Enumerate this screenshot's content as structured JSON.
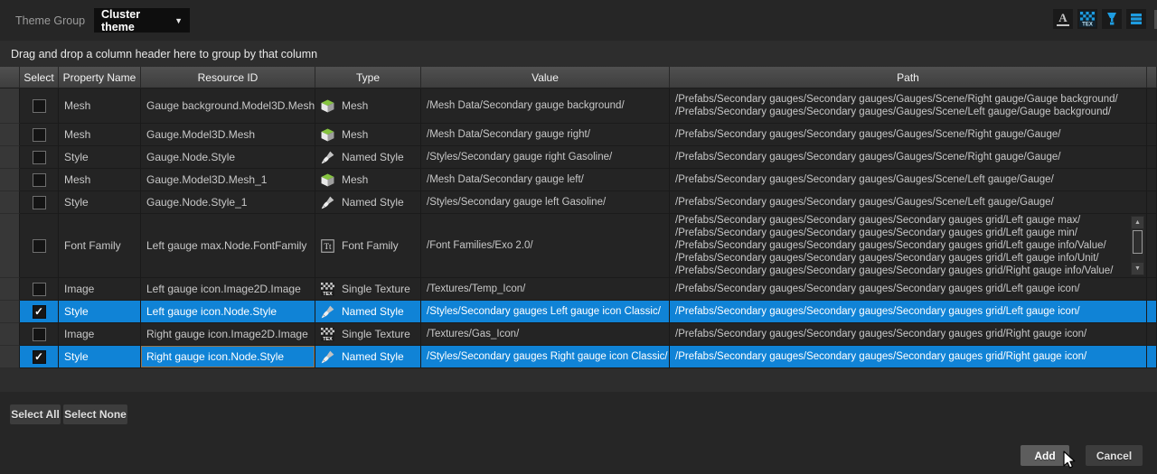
{
  "colors": {
    "selection_blue": "#1083d6",
    "icon_blue": "#1e9ce0",
    "mesh_green": "#86c440"
  },
  "toolbar": {
    "label": "Theme Group",
    "dropdown_value": "Cluster theme",
    "icons": [
      "font-icon",
      "texture-icon",
      "brush-icon",
      "list-icon"
    ]
  },
  "group_bar": "Drag and drop a column header here to group by that column",
  "table": {
    "headers": [
      "Select",
      "Property Name",
      "Resource ID",
      "Type",
      "Value",
      "Path"
    ],
    "rows": [
      {
        "checked": false,
        "selected": false,
        "focused": false,
        "property": "Mesh",
        "resource_id": "Gauge background.Model3D.Mesh",
        "type": "Mesh",
        "type_icon": "mesh-icon",
        "value": "/Mesh Data/Secondary gauge background/",
        "paths": [
          "/Prefabs/Secondary gauges/Secondary gauges/Gauges/Scene/Right gauge/Gauge background/",
          "/Prefabs/Secondary gauges/Secondary gauges/Gauges/Scene/Left gauge/Gauge background/"
        ]
      },
      {
        "checked": false,
        "selected": false,
        "focused": false,
        "property": "Mesh",
        "resource_id": "Gauge.Model3D.Mesh",
        "type": "Mesh",
        "type_icon": "mesh-icon",
        "value": "/Mesh Data/Secondary gauge right/",
        "paths": [
          "/Prefabs/Secondary gauges/Secondary gauges/Gauges/Scene/Right gauge/Gauge/"
        ]
      },
      {
        "checked": false,
        "selected": false,
        "focused": false,
        "property": "Style",
        "resource_id": "Gauge.Node.Style",
        "type": "Named Style",
        "type_icon": "named-style-icon",
        "value": "/Styles/Secondary gauge right Gasoline/",
        "paths": [
          "/Prefabs/Secondary gauges/Secondary gauges/Gauges/Scene/Right gauge/Gauge/"
        ]
      },
      {
        "checked": false,
        "selected": false,
        "focused": false,
        "property": "Mesh",
        "resource_id": "Gauge.Model3D.Mesh_1",
        "type": "Mesh",
        "type_icon": "mesh-icon",
        "value": "/Mesh Data/Secondary gauge left/",
        "paths": [
          "/Prefabs/Secondary gauges/Secondary gauges/Gauges/Scene/Left gauge/Gauge/"
        ]
      },
      {
        "checked": false,
        "selected": false,
        "focused": false,
        "property": "Style",
        "resource_id": "Gauge.Node.Style_1",
        "type": "Named Style",
        "type_icon": "named-style-icon",
        "value": "/Styles/Secondary gauge left Gasoline/",
        "paths": [
          "/Prefabs/Secondary gauges/Secondary gauges/Gauges/Scene/Left gauge/Gauge/"
        ]
      },
      {
        "checked": false,
        "selected": false,
        "focused": false,
        "property": "Font Family",
        "resource_id": "Left gauge max.Node.FontFamily",
        "type": "Font Family",
        "type_icon": "font-family-icon",
        "value": "/Font Families/Exo 2.0/",
        "paths": [
          "/Prefabs/Secondary gauges/Secondary gauges/Secondary gauges grid/Left gauge max/",
          "/Prefabs/Secondary gauges/Secondary gauges/Secondary gauges grid/Left gauge min/",
          "/Prefabs/Secondary gauges/Secondary gauges/Secondary gauges grid/Left gauge info/Value/",
          "/Prefabs/Secondary gauges/Secondary gauges/Secondary gauges grid/Left gauge info/Unit/",
          "/Prefabs/Secondary gauges/Secondary gauges/Secondary gauges grid/Right gauge info/Value/"
        ]
      },
      {
        "checked": false,
        "selected": false,
        "focused": false,
        "property": "Image",
        "resource_id": "Left gauge icon.Image2D.Image",
        "type": "Single Texture",
        "type_icon": "single-texture-icon",
        "value": "/Textures/Temp_Icon/",
        "paths": [
          "/Prefabs/Secondary gauges/Secondary gauges/Secondary gauges grid/Left gauge icon/"
        ]
      },
      {
        "checked": true,
        "selected": true,
        "focused": false,
        "property": "Style",
        "resource_id": "Left gauge icon.Node.Style",
        "type": "Named Style",
        "type_icon": "named-style-icon",
        "value": "/Styles/Secondary gauges Left gauge icon Classic/",
        "paths": [
          "/Prefabs/Secondary gauges/Secondary gauges/Secondary gauges grid/Left gauge icon/"
        ]
      },
      {
        "checked": false,
        "selected": false,
        "focused": false,
        "property": "Image",
        "resource_id": "Right gauge icon.Image2D.Image",
        "type": "Single Texture",
        "type_icon": "single-texture-icon",
        "value": "/Textures/Gas_Icon/",
        "paths": [
          "/Prefabs/Secondary gauges/Secondary gauges/Secondary gauges grid/Right gauge icon/"
        ]
      },
      {
        "checked": true,
        "selected": true,
        "focused": true,
        "property": "Style",
        "resource_id": "Right gauge icon.Node.Style",
        "type": "Named Style",
        "type_icon": "named-style-icon",
        "value": "/Styles/Secondary gauges Right gauge icon Classic/",
        "paths": [
          "/Prefabs/Secondary gauges/Secondary gauges/Secondary gauges grid/Right gauge icon/"
        ]
      }
    ]
  },
  "footer": {
    "select_all": "Select All",
    "select_none": "Select None"
  },
  "dialog_buttons": {
    "add": "Add",
    "cancel": "Cancel"
  }
}
